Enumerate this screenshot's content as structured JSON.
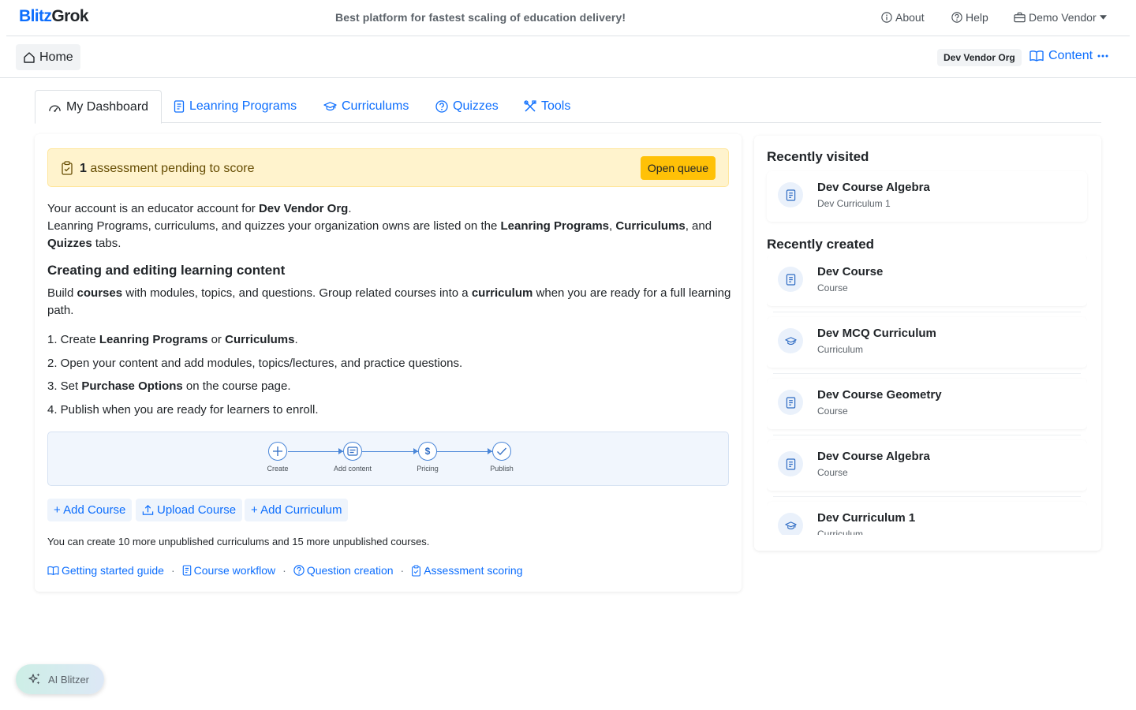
{
  "header": {
    "logo_part1": "Blitz",
    "logo_part2": "Grok",
    "tagline": "Best platform for fastest scaling of education delivery!",
    "about": "About",
    "help": "Help",
    "account": "Demo Vendor"
  },
  "secbar": {
    "home": "Home",
    "org": "Dev Vendor Org",
    "content": "Content"
  },
  "tabs": [
    {
      "label": "My Dashboard"
    },
    {
      "label": "Leanring Programs"
    },
    {
      "label": "Curriculums"
    },
    {
      "label": "Quizzes"
    },
    {
      "label": "Tools"
    }
  ],
  "alert": {
    "count": "1",
    "text": " assessment pending to score",
    "button": "Open queue"
  },
  "intro": {
    "l1_a": "Your account is an educator account for ",
    "l1_b": "Dev Vendor Org",
    "l1_c": ".",
    "l2_a": "Leanring Programs, curriculums, and quizzes your organization owns are listed on the ",
    "l2_b": "Leanring Programs",
    "l2_c": ", ",
    "l2_d": "Curriculums",
    "l2_e": ", and ",
    "l2_f": "Quizzes",
    "l2_g": " tabs."
  },
  "section": {
    "title": "Creating and editing learning content",
    "p_a": "Build ",
    "p_b": "courses",
    "p_c": " with modules, topics, and questions. Group related courses into a ",
    "p_d": "curriculum",
    "p_e": " when you are ready for a full learning path."
  },
  "steps": {
    "s1_a": "1. Create ",
    "s1_b": "Leanring Programs",
    "s1_c": " or ",
    "s1_d": "Curriculums",
    "s1_e": ".",
    "s2": "2. Open your content and add modules, topics/lectures, and practice questions.",
    "s3_a": "3. Set ",
    "s3_b": "Purchase Options",
    "s3_c": " on the course page.",
    "s4": "4. Publish when you are ready for learners to enroll."
  },
  "workflow": [
    {
      "label": "Create"
    },
    {
      "label": "Add content"
    },
    {
      "label": "Pricing",
      "glyph": "$"
    },
    {
      "label": "Publish"
    }
  ],
  "actions": {
    "add_course": "+ Add Course",
    "upload_course": "Upload Course",
    "add_curriculum": "+ Add Curriculum"
  },
  "limit_note": "You can create 10 more unpublished curriculums and 15 more unpublished courses.",
  "guides": {
    "getting_started": "Getting started guide",
    "sep": "·",
    "course_workflow": "Course workflow",
    "question_creation": "Question creation",
    "assessment_scoring": "Assessment scoring"
  },
  "side": {
    "recently_visited": "Recently visited",
    "visited": [
      {
        "title": "Dev Course Algebra",
        "sub": "Dev Curriculum 1",
        "icon": "course-icon"
      }
    ],
    "recently_created": "Recently created",
    "created": [
      {
        "title": "Dev Course",
        "sub": "Course",
        "icon": "course-icon"
      },
      {
        "title": "Dev MCQ Curriculum",
        "sub": "Curriculum",
        "icon": "graduation-cap-icon"
      },
      {
        "title": "Dev Course Geometry",
        "sub": "Course",
        "icon": "course-icon"
      },
      {
        "title": "Dev Course Algebra",
        "sub": "Course",
        "icon": "course-icon"
      },
      {
        "title": "Dev Curriculum 1",
        "sub": "Curriculum",
        "icon": "graduation-cap-icon"
      }
    ]
  },
  "ai_button": "AI Blitzer",
  "colors": {
    "primary": "#0d6efd",
    "warning_bg": "#fff3cd",
    "warning_button": "#ffc107",
    "workflow_bg": "#f1f6fd"
  }
}
